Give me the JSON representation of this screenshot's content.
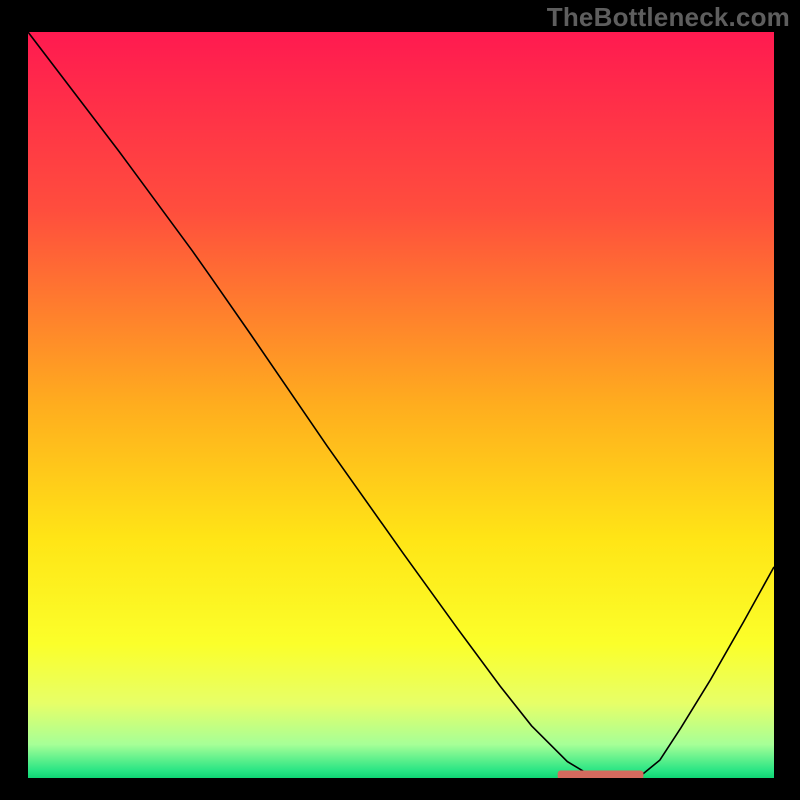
{
  "watermark": "TheBottleneck.com",
  "chart_data": {
    "type": "line",
    "title": "",
    "xlabel": "",
    "ylabel": "",
    "xlim": [
      0,
      100
    ],
    "ylim": [
      0,
      100
    ],
    "background_gradient": {
      "stops": [
        {
          "offset": 0.0,
          "color": "#ff1a50"
        },
        {
          "offset": 0.24,
          "color": "#ff4e3d"
        },
        {
          "offset": 0.5,
          "color": "#ffad1e"
        },
        {
          "offset": 0.68,
          "color": "#ffe516"
        },
        {
          "offset": 0.82,
          "color": "#fbff2a"
        },
        {
          "offset": 0.9,
          "color": "#e7ff68"
        },
        {
          "offset": 0.955,
          "color": "#a6ff97"
        },
        {
          "offset": 0.99,
          "color": "#29e584"
        },
        {
          "offset": 1.0,
          "color": "#0fd574"
        }
      ]
    },
    "series": [
      {
        "name": "bottleneck-curve",
        "color": "#000000",
        "width": 1.6,
        "x": [
          0.0,
          12.2,
          22.0,
          24.4,
          29.9,
          40.1,
          50.3,
          57.6,
          63.3,
          67.5,
          72.3,
          75.3,
          78.1,
          80.6,
          82.5,
          84.7,
          87.5,
          91.5,
          95.9,
          100.0
        ],
        "y": [
          100.0,
          84.0,
          70.7,
          67.3,
          59.4,
          44.5,
          30.1,
          20.0,
          12.3,
          7.0,
          2.2,
          0.4,
          0.0,
          0.2,
          0.6,
          2.4,
          6.7,
          13.2,
          20.9,
          28.3
        ]
      }
    ],
    "markers": [
      {
        "name": "optimal-range-marker",
        "shape": "rounded-rect",
        "color": "#d46a5e",
        "x_start": 71.0,
        "x_end": 82.5,
        "y": 0.4,
        "height": 1.2
      }
    ]
  }
}
